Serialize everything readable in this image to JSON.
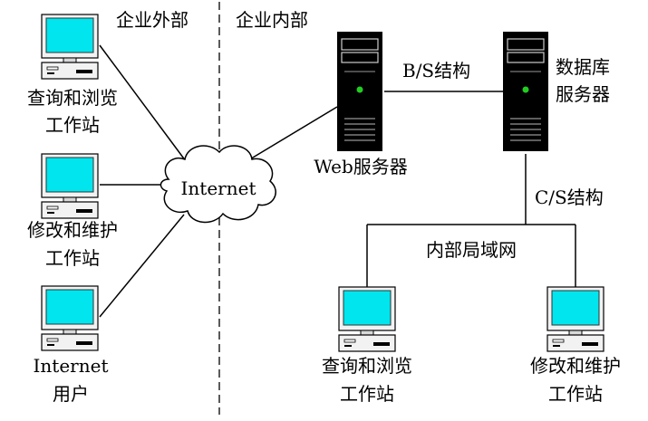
{
  "zones": {
    "outside": "企业外部",
    "inside": "企业内部"
  },
  "internet": "Internet",
  "web_server": "Web服务器",
  "db_server": [
    "数据库",
    "服务器"
  ],
  "bs_structure": "B/S结构",
  "cs_structure": "C/S结构",
  "lan": "内部局域网",
  "external_clients": [
    {
      "line1": "查询和浏览",
      "line2": "工作站"
    },
    {
      "line1": "修改和维护",
      "line2": "工作站"
    },
    {
      "line1": "Internet",
      "line2": "用户"
    }
  ],
  "internal_clients": [
    {
      "line1": "查询和浏览",
      "line2": "工作站"
    },
    {
      "line1": "修改和维护",
      "line2": "工作站"
    }
  ],
  "colors": {
    "screen": "#00e5ee",
    "screen_border": "#0a6a70",
    "cloud_fill": "#ffffff",
    "server_body": "#000000",
    "led": "#22cc22",
    "line": "#000000"
  }
}
